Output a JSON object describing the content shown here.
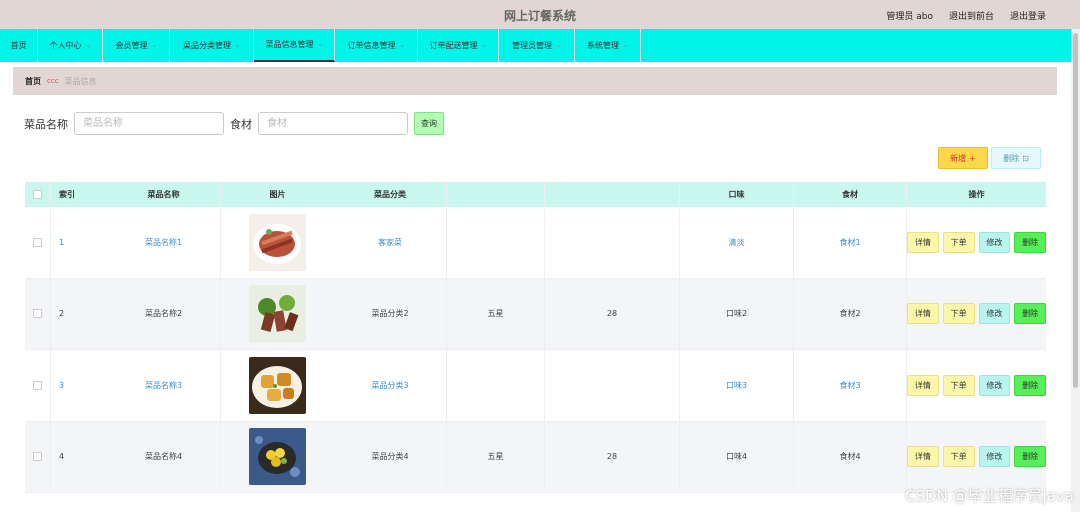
{
  "header": {
    "title": "网上订餐系统",
    "user_label": "管理员 abo",
    "front_label": "退出到前台",
    "logout_label": "退出登录"
  },
  "nav": {
    "items": [
      {
        "label": "首页",
        "has_menu": false
      },
      {
        "label": "个人中心",
        "has_menu": true
      },
      {
        "label": "会员管理",
        "has_menu": true
      },
      {
        "label": "菜品分类管理",
        "has_menu": true
      },
      {
        "label": "菜品信息管理",
        "has_menu": true,
        "active": true
      },
      {
        "label": "订单信息管理",
        "has_menu": true
      },
      {
        "label": "订单配送管理",
        "has_menu": true
      },
      {
        "label": "管理员管理",
        "has_menu": true
      },
      {
        "label": "系统管理",
        "has_menu": true
      }
    ]
  },
  "breadcrumb": {
    "home": "首页",
    "separator": "ccc",
    "current": "菜品信息"
  },
  "search": {
    "name_label": "菜品名称",
    "name_placeholder": "菜品名称",
    "ing_label": "食材",
    "ing_placeholder": "食材",
    "query_label": "查询"
  },
  "actions": {
    "add_label": "新增",
    "add_icon": "+",
    "delete_label": "删除",
    "delete_icon": "⊡"
  },
  "table": {
    "headers": {
      "index": "索引",
      "name": "菜品名称",
      "image": "图片",
      "category": "菜品分类",
      "star": "",
      "price": "",
      "taste": "口味",
      "ingredient": "食材",
      "operation": "操作"
    },
    "rows": [
      {
        "index": "1",
        "name": "菜品名称1",
        "category": "客家菜",
        "star": "",
        "price": "",
        "taste": "清淡",
        "ingredient": "食材1"
      },
      {
        "index": "2",
        "name": "菜品名称2",
        "category": "菜品分类2",
        "star": "五星",
        "price": "28",
        "taste": "口味2",
        "ingredient": "食材2"
      },
      {
        "index": "3",
        "name": "菜品名称3",
        "category": "菜品分类3",
        "star": "",
        "price": "",
        "taste": "口味3",
        "ingredient": "食材3"
      },
      {
        "index": "4",
        "name": "菜品名称4",
        "category": "菜品分类4",
        "star": "五星",
        "price": "28",
        "taste": "口味4",
        "ingredient": "食材4"
      }
    ],
    "op_labels": {
      "detail": "详情",
      "order": "下单",
      "edit": "修改",
      "delete": "删除"
    }
  },
  "watermark": "CSDN @毕业程序员java",
  "colors": {
    "nav_bg": "#00f5e8",
    "header_bg": "#e2d6d4",
    "table_head_bg": "#c9f7ed",
    "link": "#3a8fd0",
    "delete_btn": "#57ef57"
  }
}
